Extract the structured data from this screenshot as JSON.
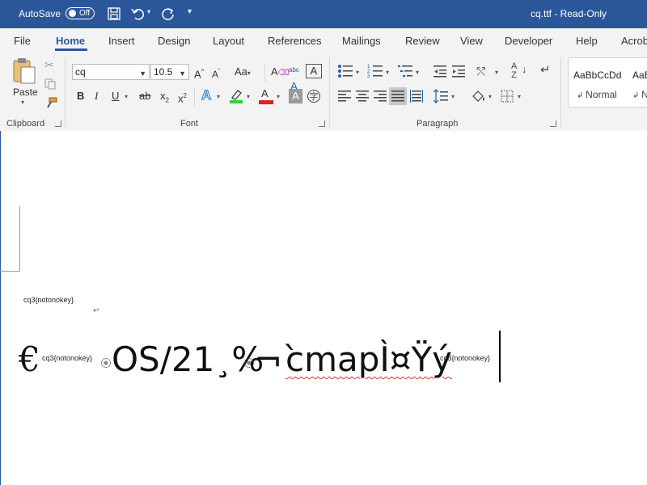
{
  "titlebar": {
    "autosave_label": "AutoSave",
    "autosave_state": "Off",
    "doc_title": "cq.ttf  -  Read-Only"
  },
  "tabs": [
    "File",
    "Home",
    "Insert",
    "Design",
    "Layout",
    "References",
    "Mailings",
    "Review",
    "View",
    "Developer",
    "Help",
    "Acrob"
  ],
  "active_tab": "Home",
  "ribbon": {
    "clipboard": {
      "paste_label": "Paste",
      "group_label": "Clipboard"
    },
    "font": {
      "font_name": "cq",
      "font_size": "10.5",
      "group_label": "Font",
      "grow": "A",
      "shrink": "A",
      "case": "Aa",
      "bold": "B",
      "italic": "I",
      "underline": "U",
      "strike": "ab",
      "subscript": "x",
      "subscript_mark": "2",
      "superscript": "x",
      "superscript_mark": "2",
      "text_effects": "A",
      "font_color_glyph": "A",
      "char_shading": "A",
      "highlight_color": "#2dd42d",
      "font_color": "#e02020"
    },
    "paragraph": {
      "group_label": "Paragraph"
    },
    "styles": {
      "sample_1": "AaBbCcDd",
      "name_1": "Normal",
      "sample_2": "AaB",
      "name_2": "N"
    }
  },
  "document": {
    "line1_text": "cq3{notonokey}",
    "paragraph_mark": "↵",
    "line2": {
      "euro": "€",
      "tag1": "cq3{notonokey}",
      "run1": "OS/21",
      "run1b": "¸%",
      "run2": "¬`",
      "run3": "cmapÌ¤Ÿý",
      "tag2": "cq3{notonokey}"
    }
  }
}
